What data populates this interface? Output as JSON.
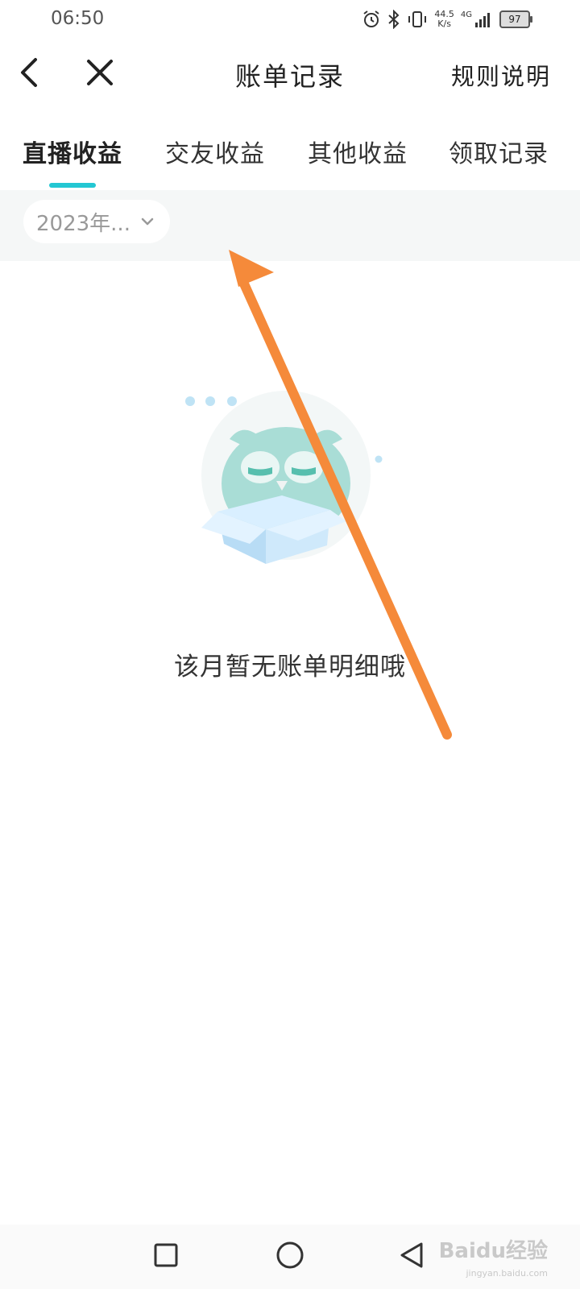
{
  "status_bar": {
    "time": "06:50",
    "icons": [
      "alarm-icon",
      "bluetooth-icon",
      "vibrate-icon",
      "signal-icon"
    ],
    "net_speed_value": "44.5",
    "net_speed_unit": "K/s",
    "network_type": "4G",
    "battery": "97"
  },
  "nav": {
    "title": "账单记录",
    "rules_label": "规则说明",
    "back_icon": "chevron-left-icon",
    "close_icon": "close-icon"
  },
  "tabs": [
    {
      "label": "直播收益",
      "active": true
    },
    {
      "label": "交友收益",
      "active": false
    },
    {
      "label": "其他收益",
      "active": false
    },
    {
      "label": "领取记录",
      "active": false
    }
  ],
  "filter": {
    "month": "2023年...",
    "chevron_icon": "chevron-down-icon"
  },
  "empty_state": {
    "message": "该月暂无账单明细哦",
    "illustration": "owl-with-box-illustration"
  },
  "annotation": {
    "color": "#f58a3a"
  },
  "bottom_nav": {
    "icons": [
      "recents-square-icon",
      "home-circle-icon",
      "back-triangle-icon"
    ]
  },
  "watermark": {
    "logo_text": "Baidu经验",
    "url": "jingyan.baidu.com"
  },
  "colors": {
    "accent": "#23c7d3",
    "filter_bg": "#f5f7f7"
  }
}
